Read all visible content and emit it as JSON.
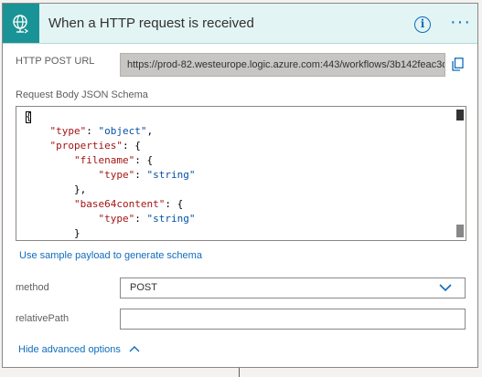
{
  "trigger": {
    "title": "When a HTTP request is received",
    "header_color": "#1a9396",
    "icon": "globe-request-icon",
    "info_icon": "info-icon",
    "more_icon": "more-options-icon",
    "more_label": "···"
  },
  "http_post_url": {
    "label": "HTTP POST URL",
    "value": "https://prod-82.westeurope.logic.azure.com:443/workflows/3b142feac3d...",
    "copy_icon": "copy-icon"
  },
  "schema": {
    "label": "Request Body JSON Schema",
    "lines": [
      "{",
      "    \"type\": \"object\",",
      "    \"properties\": {",
      "        \"filename\": {",
      "            \"type\": \"string\"",
      "        },",
      "        \"base64content\": {",
      "            \"type\": \"string\"",
      "        }",
      "    }"
    ]
  },
  "sample_payload_link": "Use sample payload to generate schema",
  "method": {
    "label": "method",
    "value": "POST"
  },
  "relative_path": {
    "label": "relativePath",
    "value": ""
  },
  "hide_advanced": "Hide advanced options",
  "accent_color": "#0f6cbd"
}
